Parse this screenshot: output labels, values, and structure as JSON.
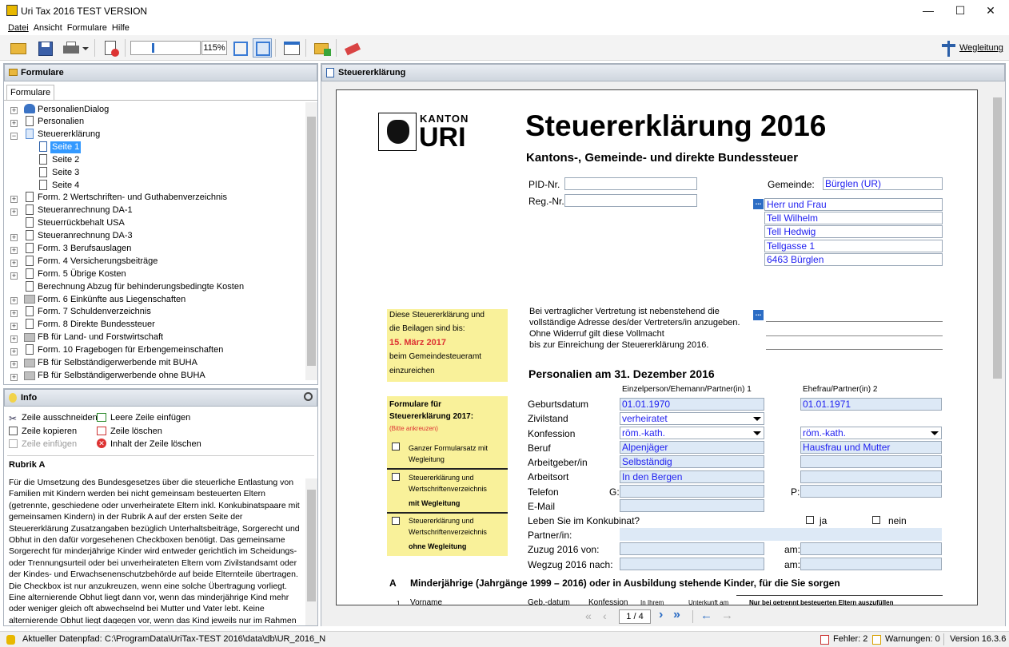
{
  "window": {
    "title": "Uri Tax 2016 TEST VERSION",
    "minimize": "—",
    "maximize": "☐",
    "close": "✕"
  },
  "menu": [
    "Datei",
    "Ansicht",
    "Formulare",
    "Hilfe"
  ],
  "toolbar": {
    "zoom": "115%",
    "help_label": "Wegleitung"
  },
  "left": {
    "header": "Formulare",
    "tab": "Formulare",
    "tree": [
      "PersonalienDialog",
      "Personalien",
      "Steuererklärung",
      "Seite 1",
      "Seite 2",
      "Seite 3",
      "Seite 4",
      "Form. 2 Wertschriften- und Guthabenverzeichnis",
      "Steueranrechnung DA-1",
      "Steuerrückbehalt USA",
      "Steueranrechnung DA-3",
      "Form. 3 Berufsauslagen",
      "Form. 4 Versicherungsbeiträge",
      "Form. 5 Übrige Kosten",
      "Berechnung Abzug für behinderungsbedingte Kosten",
      "Form. 6 Einkünfte aus Liegenschaften",
      "Form. 7 Schuldenverzeichnis",
      "Form. 8 Direkte Bundessteuer",
      "FB für Land- und Forstwirtschaft",
      "Form. 10 Fragebogen für Erbengemeinschaften",
      "FB für Selbständigerwerbende mit BUHA",
      "FB für Selbständigerwerbende ohne BUHA"
    ]
  },
  "info": {
    "header": "Info",
    "actions": [
      "Zeile ausschneiden",
      "Leere Zeile einfügen",
      "Zeile kopieren",
      "Zeile löschen",
      "Zeile einfügen",
      "Inhalt der Zeile löschen"
    ],
    "rubrik": "Rubrik A",
    "text": "Für die Umsetzung des Bundesgesetzes über die steuerliche Entlastung von Familien mit Kindern werden bei nicht gemeinsam besteuerten Eltern (getrennte, geschiedene oder unverheiratete Eltern inkl. Konkubinatspaare mit gemeinsamen Kindern) in der Rubrik A auf der ersten Seite der Steuererklärung Zusatzangaben bezüglich Unterhaltsbeiträge, Sorgerecht und Obhut in den dafür vorgesehenen Checkboxen benötigt. Das gemeinsame Sorgerecht für minderjährige Kinder wird entweder gerichtlich im Scheidungs- oder Trennungsurteil oder bei unverheirateten Eltern vom Zivilstandsamt oder der Kindes- und Erwachsenenschutzbehörde auf beide Elternteile übertragen. Die Checkbox ist nur anzukreuzen, wenn eine solche Übertragung vorliegt. Eine alternierende Obhut liegt dann vor, wenn das minderjährige Kind mehr oder weniger gleich oft abwechselnd bei Mutter und Vater lebt. Keine alternierende Obhut liegt dagegen vor, wenn das Kind jeweils nur im Rahmen des Besuchsrechts das Wochenende oder die Ferien beim anderen Elternteil"
  },
  "right": {
    "header": "Steuererklärung"
  },
  "doc": {
    "kanton": "KANTON",
    "uri": "URI",
    "title": "Steuererklärung 2016",
    "subtitle": "Kantons-, Gemeinde- und direkte Bundessteuer",
    "pid": "PID-Nr.",
    "reg": "Reg.-Nr.",
    "gemeinde_lbl": "Gemeinde:",
    "gemeinde": "Bürglen (UR)",
    "address": [
      "Herr und Frau",
      "Tell Wilhelm",
      "Tell Hedwig",
      "Tellgasse 1",
      "6463 Bürglen"
    ],
    "yellow1": [
      "Diese Steuererklärung und",
      "die Beilagen sind bis:",
      "15. März 2017",
      "beim Gemeindesteueramt",
      "einzureichen"
    ],
    "vertreter": [
      "Bei vertraglicher Vertretung ist nebenstehend die",
      "vollständige Adresse des/der Vertreters/in anzugeben.",
      "Ohne Widerruf gilt diese Vollmacht",
      "bis zur Einreichung der Steuererklärung 2016."
    ],
    "personalien": "Personalien am 31. Dezember 2016",
    "col1": "Einzelperson/Ehemann/Partner(in) 1",
    "col2": "Ehefrau/Partner(in) 2",
    "yellow2": {
      "title1": "Formulare für",
      "title2": "Steuererklärung 2017:",
      "hint": "(Bitte ankreuzen)",
      "o1": [
        "Ganzer Formularsatz mit",
        "Wegleitung"
      ],
      "o2": [
        "Steuererklärung und",
        "Wertschriftenverzeichnis",
        "mit Wegleitung"
      ],
      "o3": [
        "Steuererklärung und",
        "Wertschriftenverzeichnis",
        "ohne Wegleitung"
      ]
    },
    "labels": [
      "Geburtsdatum",
      "Zivilstand",
      "Konfession",
      "Beruf",
      "Arbeitgeber/in",
      "Arbeitsort",
      "Telefon",
      "E-Mail",
      "Leben Sie im Konkubinat?",
      "Partner/in:",
      "Zuzug 2016 von:",
      "Wegzug 2016 nach:"
    ],
    "g": "G:",
    "p": "P:",
    "ja": "ja",
    "nein": "nein",
    "am": "am:",
    "p1": {
      "geburt": "01.01.1970",
      "zivil": "verheiratet",
      "konf": "röm.-kath.",
      "beruf": "Alpenjäger",
      "arbeitgeber": "Selbständig",
      "arbeitsort": "In den Bergen"
    },
    "p2": {
      "geburt": "01.01.1971",
      "konf": "röm.-kath.",
      "beruf": "Hausfrau und Mutter"
    },
    "sectionA_letter": "A",
    "sectionA": "Minderjährige (Jahrgänge 1999 – 2016) oder in Ausbildung stehende Kinder, für die Sie sorgen",
    "tbl": [
      "1",
      "Vorname",
      "Geb.-datum",
      "Konfession",
      "In Ihrem",
      "Unterkunft am",
      "Nur bei getrennt besteuerten Eltern auszufüllen"
    ]
  },
  "nav": {
    "page": "1 / 4"
  },
  "status": {
    "path_lbl": "Aktueller Datenpfad:",
    "path": "C:\\ProgramData\\UriTax-TEST 2016\\data\\db\\UR_2016_N",
    "errors": "Fehler: 2",
    "warnings": "Warnungen: 0",
    "version": "Version 16.3.6"
  }
}
